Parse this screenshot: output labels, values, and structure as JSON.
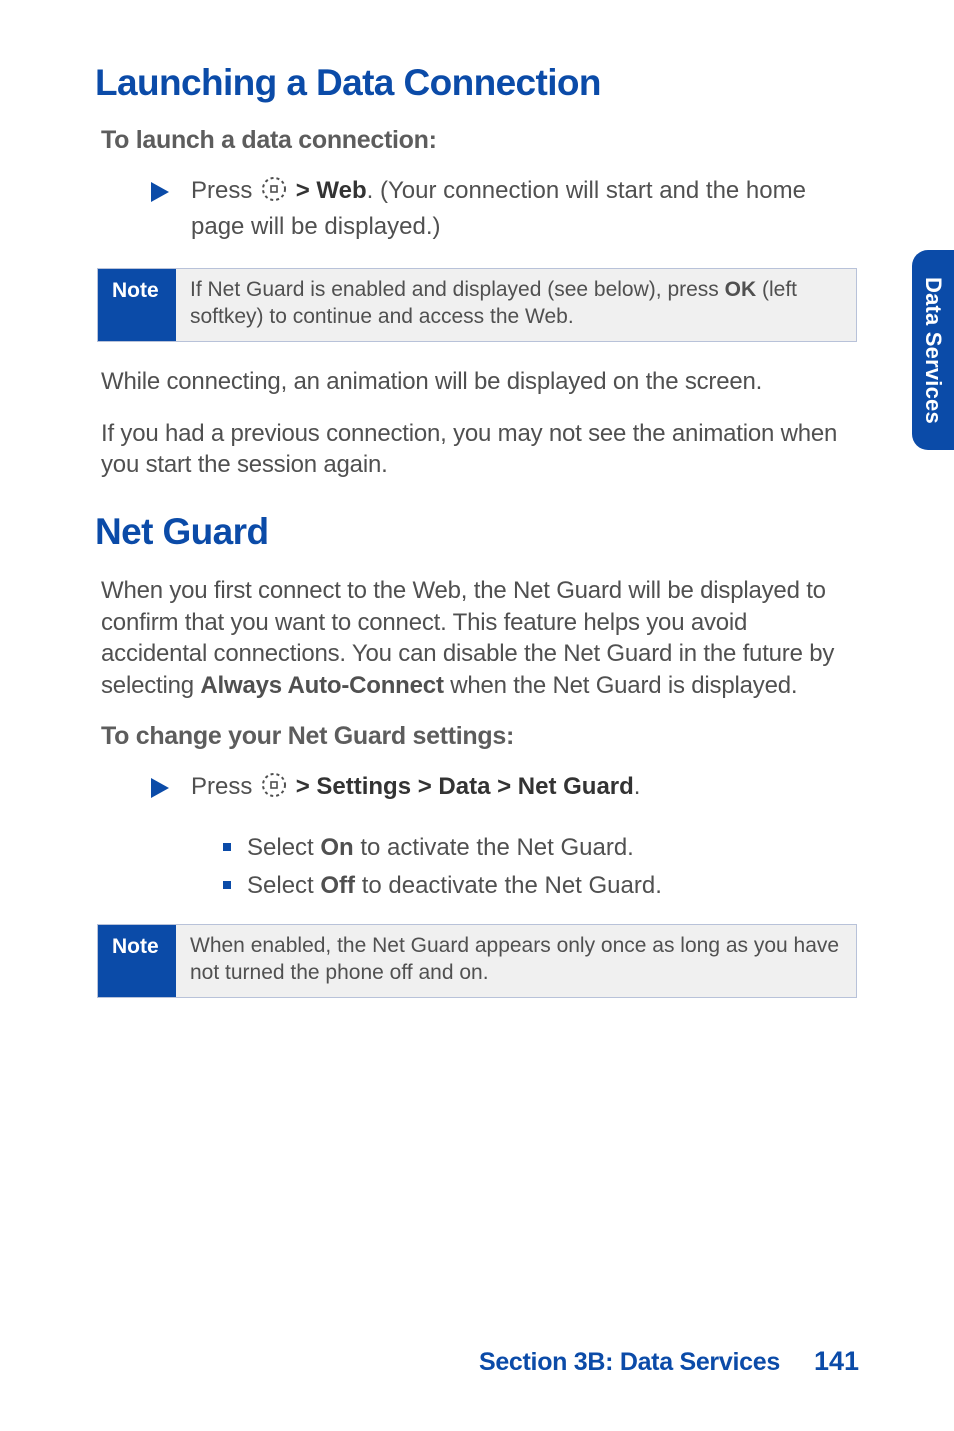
{
  "sideTab": "Data Services",
  "h1a": "Launching a Data Connection",
  "sub1": "To launch a data connection:",
  "step1_a": "Press",
  "step1_b": " > Web",
  "step1_c": ". (Your connection will start and the home page will be displayed.)",
  "note1_label": "Note",
  "note1_a": "If Net Guard is enabled and displayed (see below), press ",
  "note1_b": "OK",
  "note1_c": " (left softkey) to continue and access the Web.",
  "p1": "While connecting, an animation will be displayed on the screen.",
  "p2": "If you had a previous connection, you may not see the animation when you start the session again.",
  "h1b": "Net Guard",
  "p3_a": "When you first connect to the Web, the Net Guard will be displayed to confirm that you want to connect. This feature helps you avoid accidental connections. You can disable the Net Guard in the future by selecting ",
  "p3_b": "Always Auto-Connect",
  "p3_c": " when the Net Guard is displayed.",
  "sub2": "To change your Net Guard settings:",
  "step2_a": "Press",
  "step2_b": " > Settings > Data > Net Guard",
  "step2_c": ".",
  "li1_a": "Select ",
  "li1_b": "On",
  "li1_c": " to activate the Net Guard.",
  "li2_a": "Select ",
  "li2_b": "Off",
  "li2_c": " to deactivate the Net Guard.",
  "note2_label": "Note",
  "note2_body": "When enabled, the Net Guard appears only once as long as you have not turned the phone off and on.",
  "footer_section": "Section 3B: Data Services",
  "footer_page": "141"
}
